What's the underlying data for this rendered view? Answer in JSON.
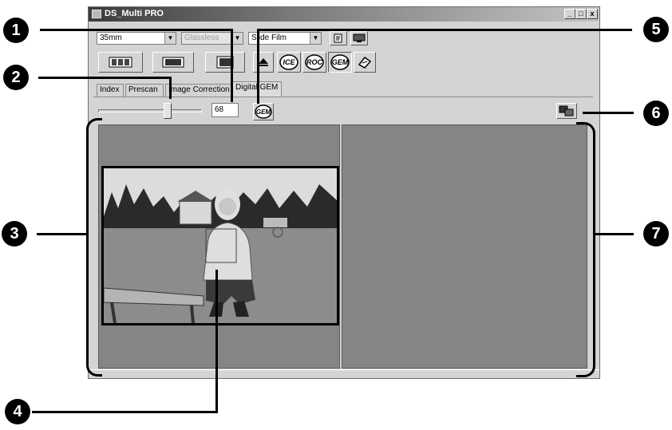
{
  "window": {
    "title": "DS_Multi PRO",
    "controls": {
      "minimize": "_",
      "maximize": "□",
      "close": "x"
    }
  },
  "toolbar": {
    "film_format": "35mm",
    "mount_type": "Glassless",
    "film_type": "Slide Film",
    "dropdown_arrow": "▼"
  },
  "function_buttons": [
    {
      "name": "index-scan-icon"
    },
    {
      "name": "prescan-icon"
    },
    {
      "name": "scan-icon"
    },
    {
      "name": "eject-icon"
    },
    {
      "name": "ice-icon",
      "label": "ICE"
    },
    {
      "name": "roc-icon",
      "label": "ROC"
    },
    {
      "name": "gem-icon",
      "label": "GEM"
    },
    {
      "name": "color-matching-icon"
    }
  ],
  "tabs": {
    "items": [
      "Index",
      "Prescan",
      "Image Correction",
      "Digital GEM"
    ],
    "active": "Digital GEM"
  },
  "gem_controls": {
    "slider_value": 0.68,
    "numeric_value": "68",
    "apply_button_label": "GEM"
  },
  "callouts": [
    "1",
    "2",
    "3",
    "4",
    "5",
    "6",
    "7"
  ],
  "colors": {
    "window_bg": "#d4d4d4",
    "pane_bg": "#858585",
    "callout": "#000000"
  }
}
